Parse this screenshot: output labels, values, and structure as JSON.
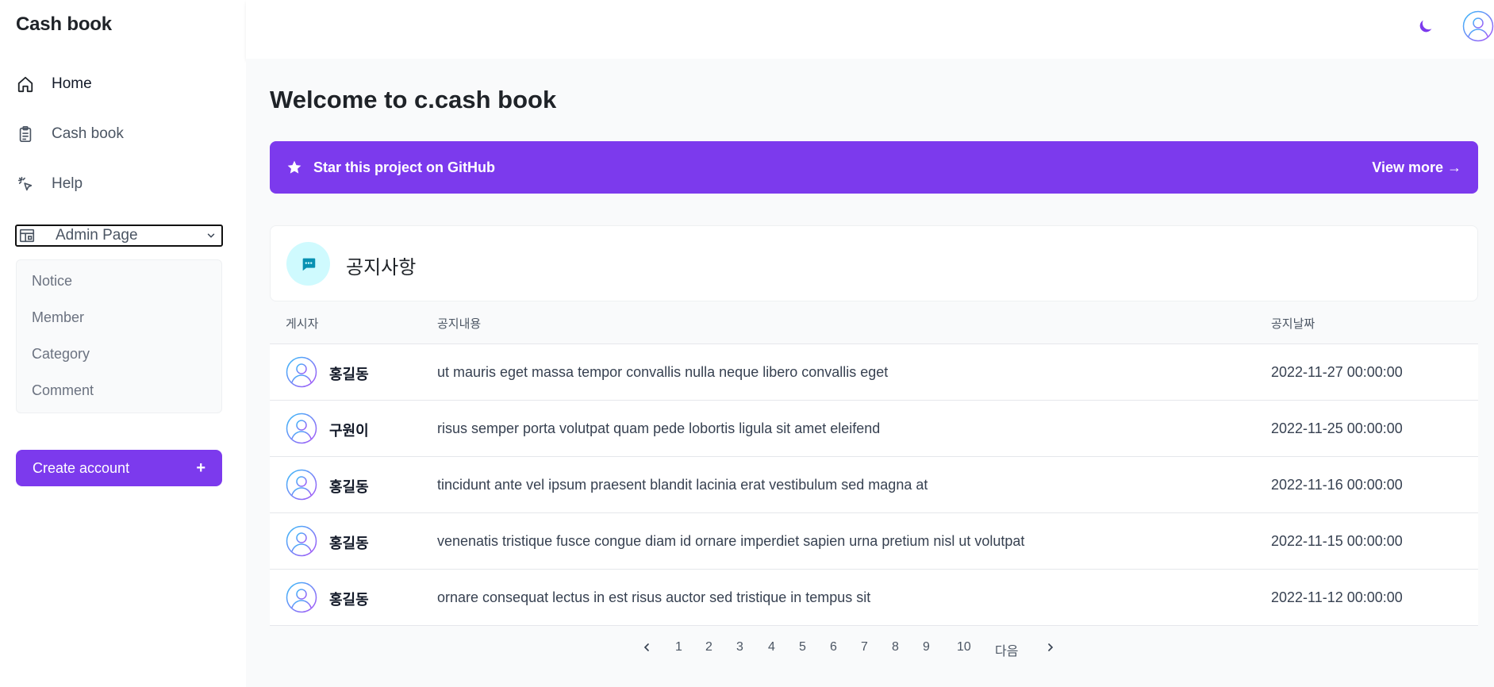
{
  "brand": "Cash book",
  "sidebar": {
    "items": [
      {
        "label": "Home",
        "icon": "home-icon"
      },
      {
        "label": "Cash book",
        "icon": "clipboard-icon"
      },
      {
        "label": "Help",
        "icon": "cursor-click-icon"
      }
    ],
    "admin": {
      "label": "Admin Page",
      "icon": "layout-icon"
    },
    "submenu": [
      "Notice",
      "Member",
      "Category",
      "Comment"
    ],
    "create_button": {
      "label": "Create account",
      "plus": "+"
    }
  },
  "main": {
    "title": "Welcome to c.cash book",
    "banner": {
      "left": "Star this project on GitHub",
      "right": "View more →"
    },
    "notice": {
      "title": "공지사항"
    },
    "table": {
      "headers": [
        "게시자",
        "공지내용",
        "공지날짜"
      ],
      "rows": [
        {
          "author": "홍길동",
          "content": "ut mauris eget massa tempor convallis nulla neque libero convallis eget",
          "date": "2022-11-27 00:00:00"
        },
        {
          "author": "구원이",
          "content": "risus semper porta volutpat quam pede lobortis ligula sit amet eleifend",
          "date": "2022-11-25 00:00:00"
        },
        {
          "author": "홍길동",
          "content": "tincidunt ante vel ipsum praesent blandit lacinia erat vestibulum sed magna at",
          "date": "2022-11-16 00:00:00"
        },
        {
          "author": "홍길동",
          "content": "venenatis tristique fusce congue diam id ornare imperdiet sapien urna pretium nisl ut volutpat",
          "date": "2022-11-15 00:00:00"
        },
        {
          "author": "홍길동",
          "content": "ornare consequat lectus in est risus auctor sed tristique in tempus sit",
          "date": "2022-11-12 00:00:00"
        }
      ]
    },
    "pager": {
      "pages": [
        "1",
        "2",
        "3",
        "4",
        "5",
        "6",
        "7",
        "8",
        "9",
        "10"
      ],
      "next": "다음"
    }
  },
  "colors": {
    "accent": "#7c3aed",
    "notice_badge": "#cffafe",
    "notice_icon": "#0891b2"
  }
}
